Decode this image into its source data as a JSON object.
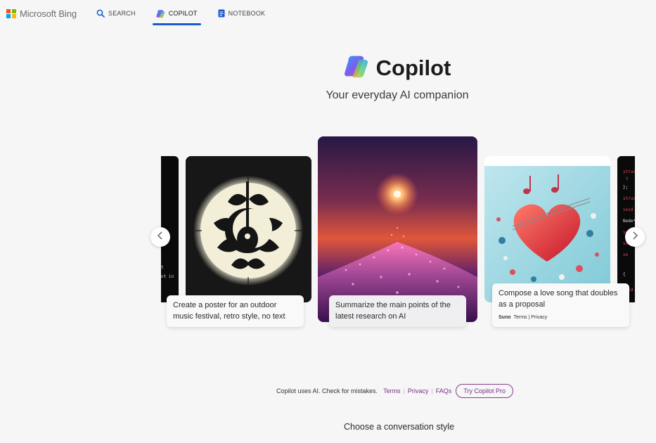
{
  "brand": {
    "name": "Microsoft Bing",
    "colors": [
      "#f25022",
      "#7fba00",
      "#00a4ef",
      "#ffb900"
    ]
  },
  "nav": [
    {
      "label": "SEARCH",
      "icon": "search-icon"
    },
    {
      "label": "COPILOT",
      "icon": "copilot-icon",
      "active": true
    },
    {
      "label": "NOTEBOOK",
      "icon": "notebook-icon"
    }
  ],
  "hero": {
    "title": "Copilot",
    "subtitle": "Your everyday AI companion"
  },
  "cards": [
    {
      "prompt": "Create a poster for an outdoor music festival, retro style, no text"
    },
    {
      "prompt": "Summarize the main points of the latest research on AI"
    },
    {
      "prompt": "Compose a love song that doubles as a proposal",
      "attribution": "Suno",
      "links": [
        "Terms",
        "Privacy"
      ]
    }
  ],
  "side_code": {
    "left": [
      "t",
      "",
      "nt in"
    ]
  },
  "footer": {
    "disclaimer": "Copilot uses AI. Check for mistakes.",
    "links": [
      "Terms",
      "Privacy",
      "FAQs"
    ],
    "pro_button": "Try Copilot Pro",
    "conversation_style": "Choose a conversation style"
  },
  "accent": "#1a5acd",
  "pro_color": "#7b2d87"
}
